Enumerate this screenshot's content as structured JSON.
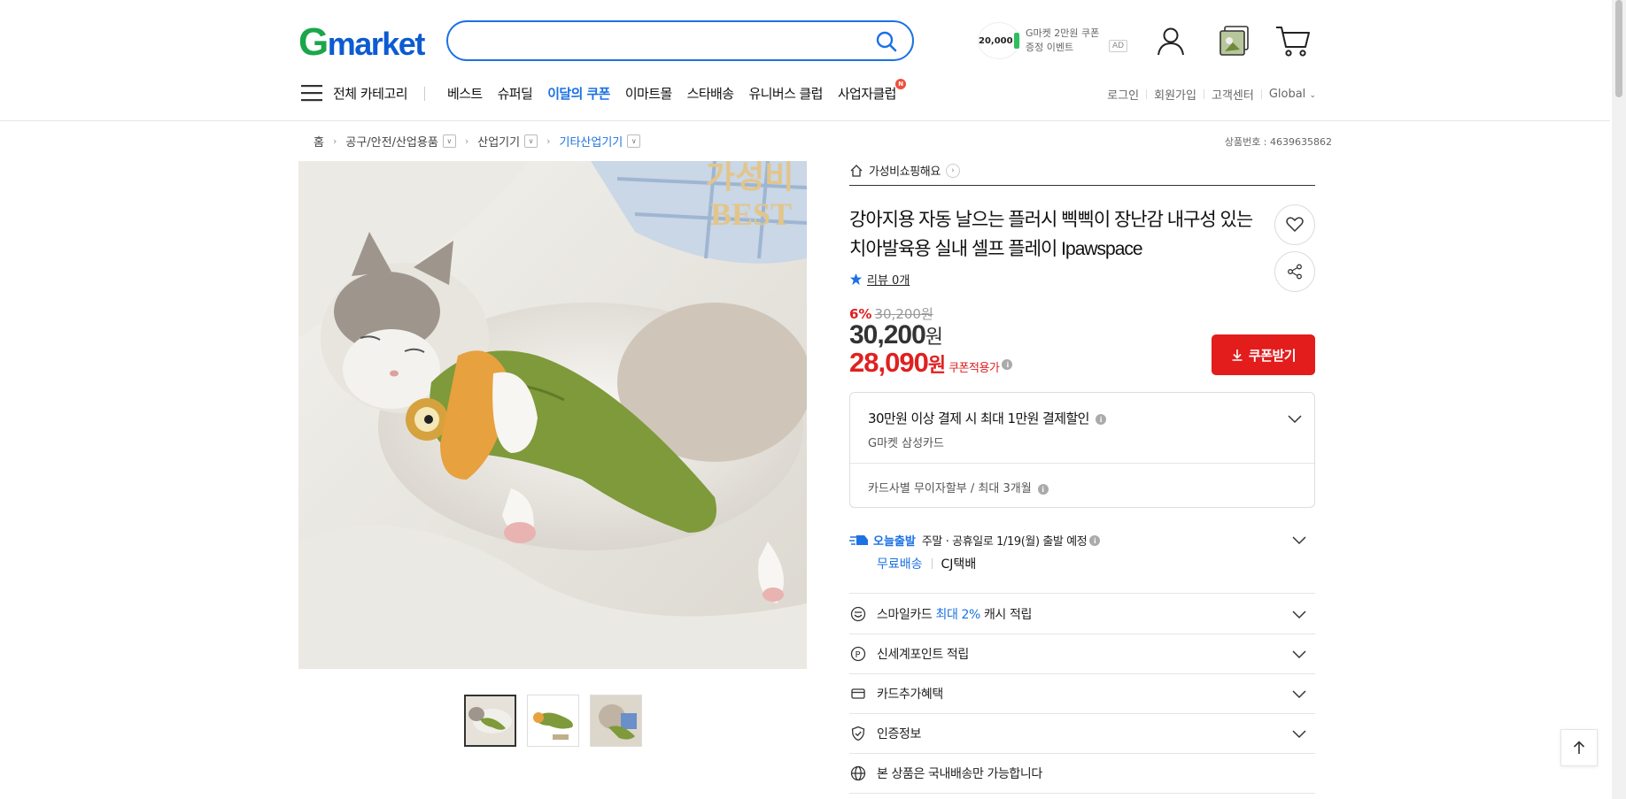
{
  "header": {
    "logo_g": "G",
    "logo_rest": "market",
    "search": {
      "placeholder": "",
      "value": ""
    },
    "promo": {
      "amount": "20,000",
      "text": "G마켓 2만원 쿠폰 증정 이벤트",
      "ad": "AD"
    },
    "icons": [
      "user-icon",
      "recent-view-icon",
      "cart-icon"
    ]
  },
  "nav": {
    "category_label": "전체 카테고리",
    "items": [
      {
        "label": "베스트",
        "highlight": false
      },
      {
        "label": "슈퍼딜",
        "highlight": false
      },
      {
        "label": "이달의 쿠폰",
        "highlight": true
      },
      {
        "label": "이마트몰",
        "highlight": false
      },
      {
        "label": "스타배송",
        "highlight": false
      },
      {
        "label": "유니버스 클럽",
        "highlight": false
      },
      {
        "label": "사업자클럽",
        "highlight": false,
        "badge": "N"
      }
    ],
    "util": {
      "login": "로그인",
      "signup": "회원가입",
      "support": "고객센터",
      "global": "Global"
    }
  },
  "breadcrumb": {
    "items": [
      "홈",
      "공구/안전/산업용품",
      "산업기기",
      "기타산업기기"
    ],
    "product_no": "상품번호 : 4639635862"
  },
  "product": {
    "image_caption_1": "가성비",
    "image_caption_2": "BEST",
    "shop_name": "가성비쇼핑해요",
    "title": "강아지용 자동 날으는 플러시 삑삑이 장난감 내구성 있는 치아발육용 실내 셀프 플레이 Ipawspace",
    "review": "리뷰 0개",
    "discount_pct": "6%",
    "original_price": "30,200원",
    "price_num": "30,200",
    "price_unit": "원",
    "coupon_price_num": "28,090",
    "coupon_price_unit": "원",
    "coupon_price_label": "쿠폰적용가",
    "coupon_button": "쿠폰받기"
  },
  "benefits": {
    "card_discount": "30만원 이상 결제 시 최대 1만원 결제할인",
    "card_name": "G마켓 삼성카드",
    "installment": "카드사별 무이자할부 / 최대 3개월"
  },
  "shipping": {
    "today_tag": "오늘출발",
    "message": "주말 · 공휴일로 1/19(월) 출발 예정",
    "free": "무료배송",
    "courier": "CJ택배"
  },
  "accordion": {
    "smile_prefix": "스마일카드",
    "smile_highlight": "최대 2%",
    "smile_suffix": "캐시 적립",
    "point": "신세계포인트 적립",
    "card_extra": "카드추가혜택",
    "cert": "인증정보",
    "domestic": "본 상품은 국내배송만 가능합니다"
  },
  "colors": {
    "brand_green": "#1ca64b",
    "brand_blue": "#0c5bd1",
    "accent_blue": "#1c72e3",
    "sale_red": "#e02020",
    "coupon_red": "#e31c1c"
  }
}
